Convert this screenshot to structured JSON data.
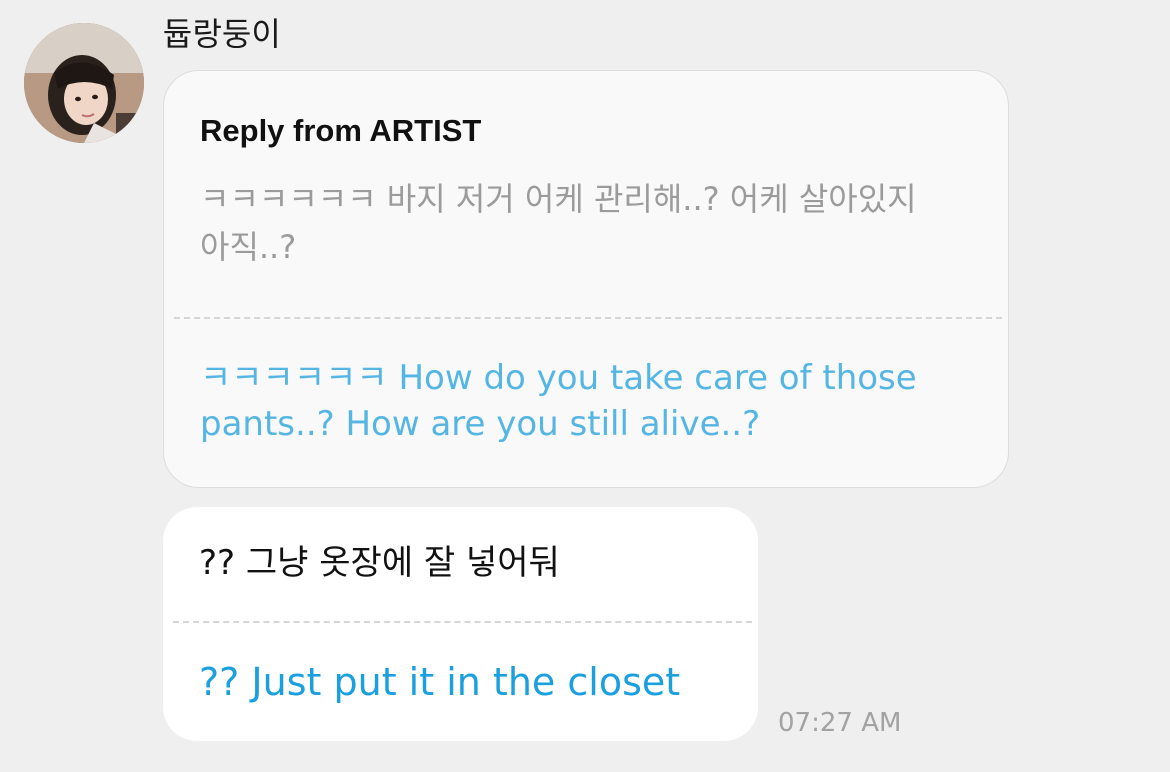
{
  "sender": {
    "name": "듑랑둥이",
    "avatar_icon": "profile-photo"
  },
  "reply": {
    "header": "Reply from ARTIST",
    "original_text": "ㅋㅋㅋㅋㅋㅋ 바지 저거 어케 관리해..? 어케 살아있지 아직..?",
    "translated_text": "ㅋㅋㅋㅋㅋㅋ How do you take care of those pants..? How are you still alive..?"
  },
  "message": {
    "original_text": "?? 그냥 옷장에 잘 넣어둬",
    "translated_text": "?? Just put it in the closet",
    "time": "07:27 AM"
  },
  "colors": {
    "background": "#efefef",
    "translation_blue": "#1a9fdf",
    "reply_translation_blue": "#55b5e3",
    "muted_gray": "#9b9b9b"
  }
}
